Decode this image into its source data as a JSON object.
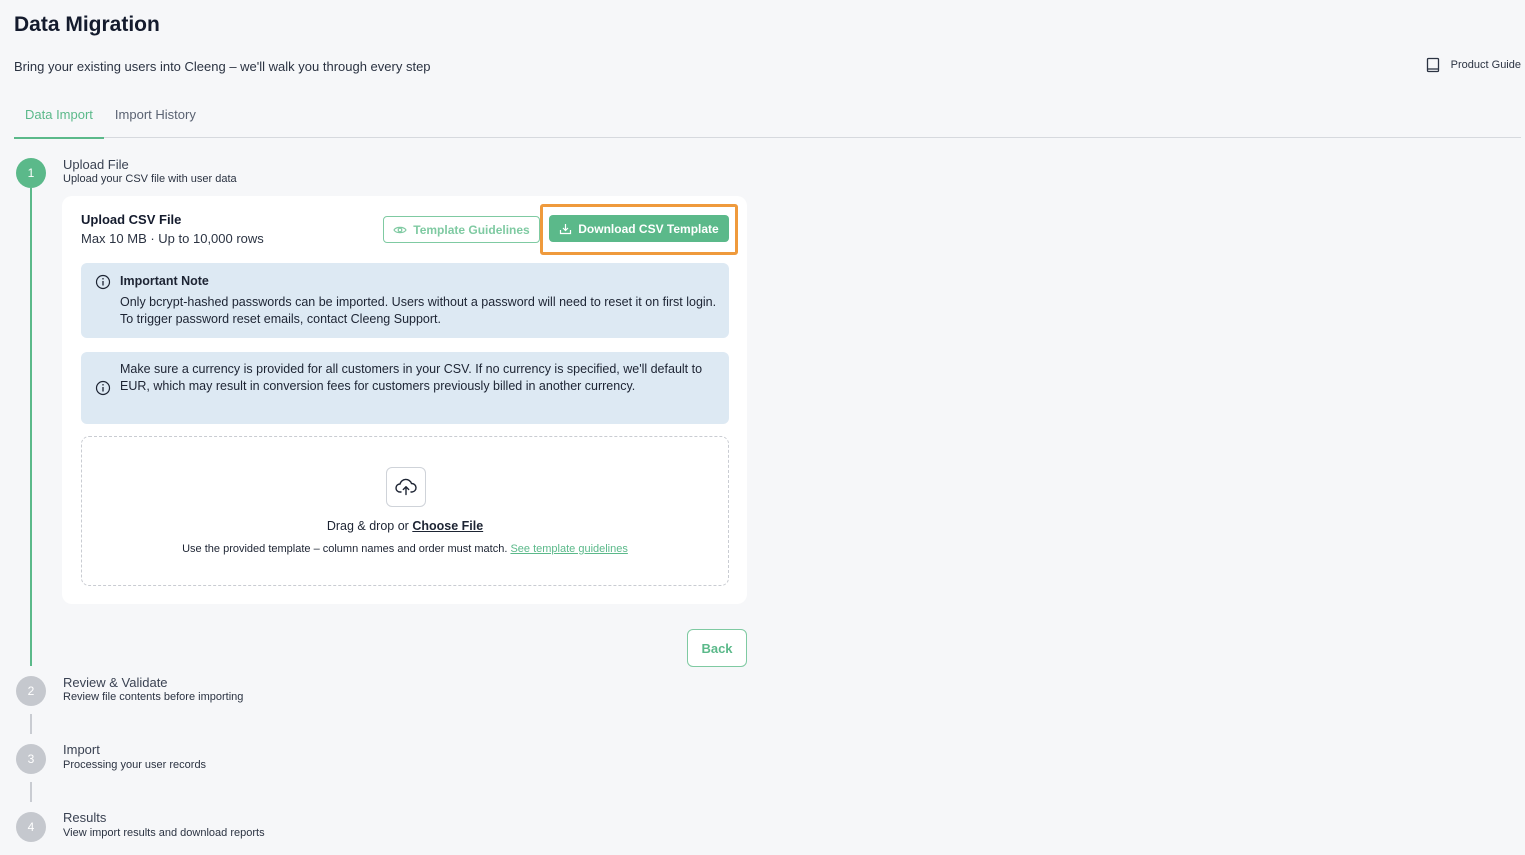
{
  "header": {
    "title": "Data Migration",
    "subtitle": "Bring your existing users into Cleeng – we'll walk you through every step",
    "product_guide_label": "Product Guide"
  },
  "tabs": [
    {
      "label": "Data Import",
      "active": true
    },
    {
      "label": "Import History",
      "active": false
    }
  ],
  "steps": [
    {
      "number": "1",
      "title": "Upload File",
      "description": "Upload your CSV file with user data",
      "state": "active"
    },
    {
      "number": "2",
      "title": "Review & Validate",
      "description": "Review file contents before importing",
      "state": "pending"
    },
    {
      "number": "3",
      "title": "Import",
      "description": "Processing your user records",
      "state": "pending"
    },
    {
      "number": "4",
      "title": "Results",
      "description": "View import results and download reports",
      "state": "pending"
    }
  ],
  "upload_card": {
    "title": "Upload CSV File",
    "limits": "Max 10 MB · Up to 10,000 rows",
    "guidelines_button": "Template Guidelines",
    "download_button": "Download CSV Template",
    "note1_title": "Important Note",
    "note1_text": "Only bcrypt-hashed passwords can be imported. Users without a password will need to reset it on first login. To trigger password reset emails, contact Cleeng Support.",
    "note2_text": "Make sure a currency is provided for all customers in your CSV. If no currency is specified, we'll default to EUR, which may result in conversion fees for customers previously billed in another currency.",
    "drop_prefix": "Drag & drop or ",
    "choose_file": "Choose File",
    "drop_hint": "Use the provided template – column names and order must match. ",
    "see_guidelines": "See template guidelines"
  },
  "back_button": "Back",
  "colors": {
    "accent": "#5bb98a",
    "highlight": "#ef9a3c",
    "note_bg": "#dde9f3"
  }
}
